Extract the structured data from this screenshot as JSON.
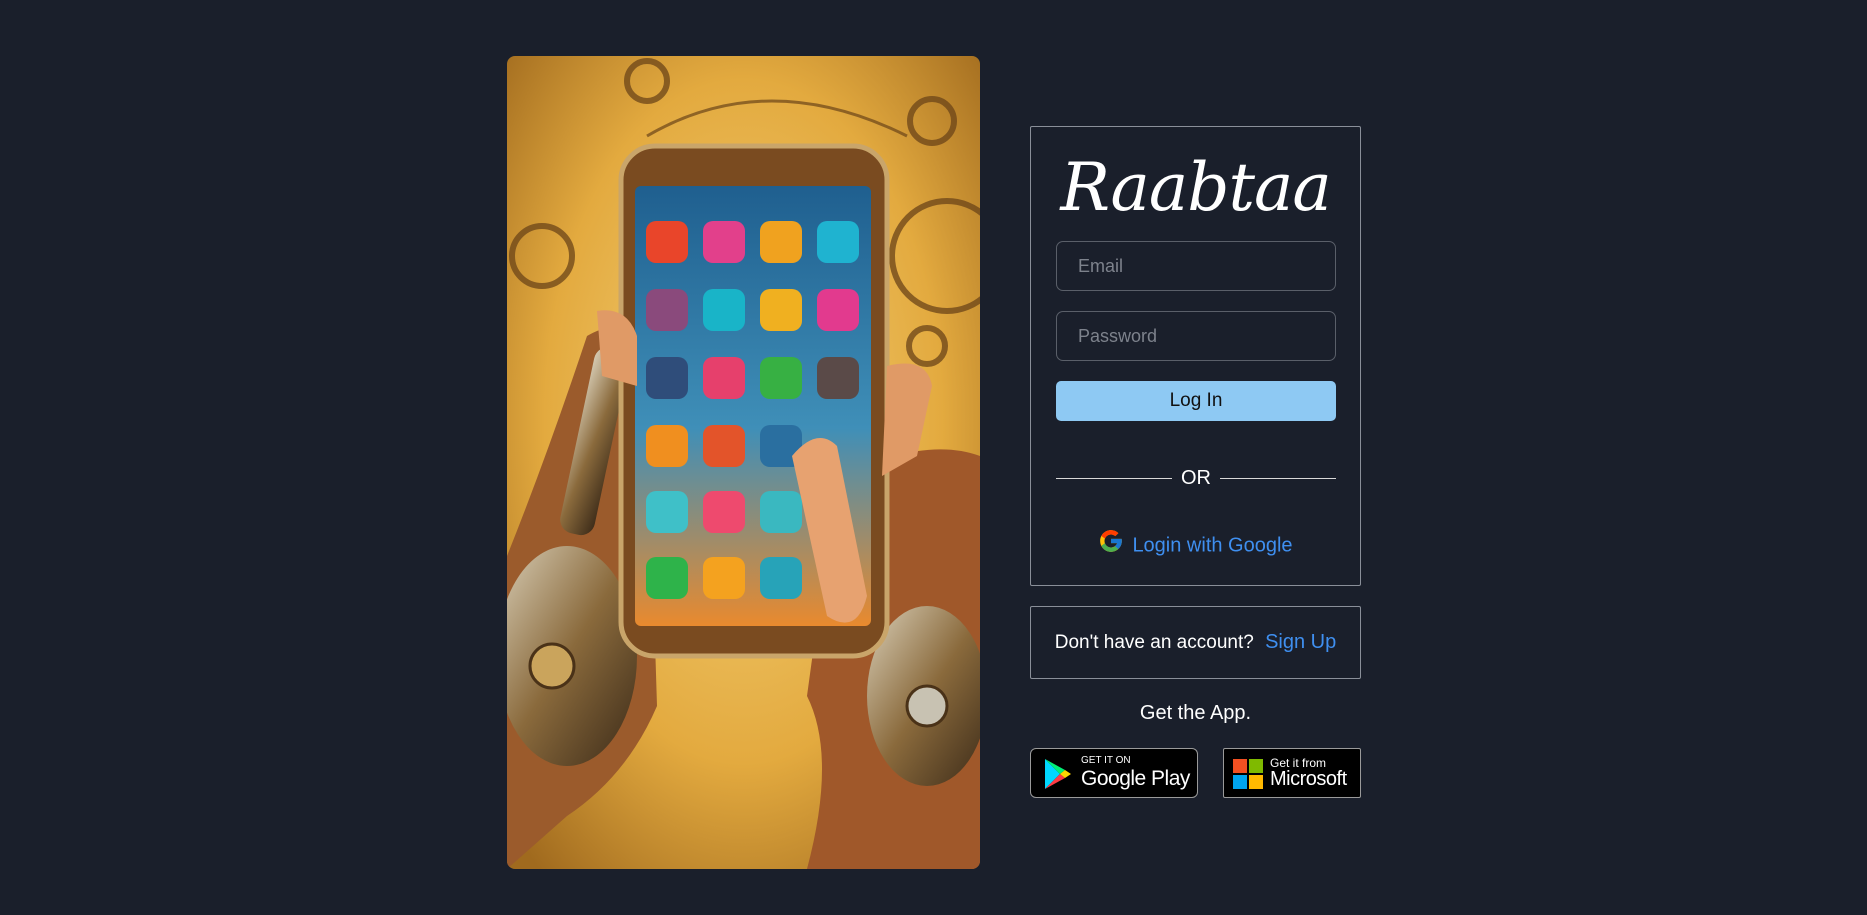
{
  "hero": {
    "image": "steampunk-hands-holding-phone-illustration"
  },
  "login": {
    "logo": "Raabtaa",
    "email_placeholder": "Email",
    "password_placeholder": "Password",
    "login_label": "Log In",
    "or_label": "OR",
    "google_label": "Login with Google"
  },
  "signup": {
    "question": "Don't have an account?",
    "link_label": "Sign Up"
  },
  "app": {
    "heading": "Get the App.",
    "google_play": {
      "small": "GET IT ON",
      "big": "Google Play"
    },
    "microsoft": {
      "small": "Get it from",
      "big": "Microsoft"
    }
  },
  "colors": {
    "background": "#1a1f2b",
    "login_button": "#8ec9f3",
    "link": "#3f8ff0"
  }
}
